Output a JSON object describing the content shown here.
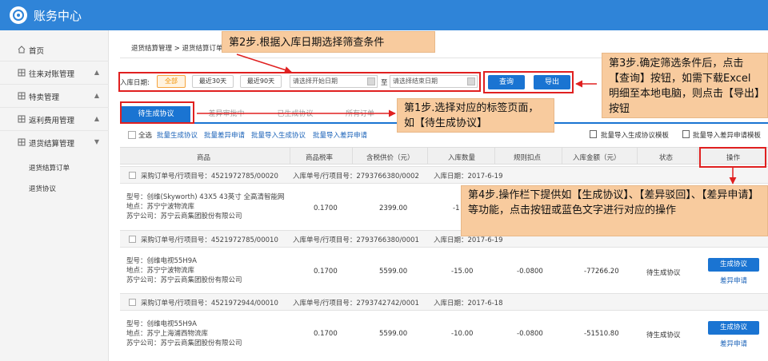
{
  "app": {
    "title": "账务中心"
  },
  "sidebar": {
    "items": [
      {
        "label": "首页"
      },
      {
        "label": "往来对账管理",
        "arrow": "▲"
      },
      {
        "label": "特卖管理",
        "arrow": "▲"
      },
      {
        "label": "返利费用管理",
        "arrow": "▲"
      },
      {
        "label": "退货结算管理",
        "arrow": "▼"
      }
    ],
    "subitems": [
      {
        "label": "退货结算订单"
      },
      {
        "label": "退货协议"
      }
    ]
  },
  "breadcrumb": "退货结算管理 > 退货结算订单",
  "filter": {
    "label": "入库日期:",
    "chips": [
      "全部",
      "最近30天",
      "最近90天"
    ],
    "start_placeholder": "请选择开始日期",
    "to": "至",
    "end_placeholder": "请选择结束日期",
    "query_label": "查询",
    "export_label": "导出"
  },
  "tabs": [
    "待生成协议",
    "差异审批中",
    "已生成协议",
    "所有订单"
  ],
  "toolbar": {
    "select_all": "全选",
    "batch_generate": "批量生成协议",
    "batch_diff_apply": "批量差异申请",
    "batch_import_generate": "批量导入生成协议",
    "batch_import_diff": "批量导入差异申请",
    "template_generate": "批量导入生成协议模板",
    "template_diff": "批量导入差异申请模板"
  },
  "table": {
    "headers": [
      "商品",
      "商品税率",
      "含税供价（元）",
      "入库数量",
      "规则扣点",
      "入库金额（元）",
      "状态",
      "操作"
    ]
  },
  "groups": [
    {
      "po": "采购订单号/行项目号：4521972785/00020",
      "receipt": "入库单号/行项目号：2793766380/0002",
      "date": "入库日期：2017-6-19",
      "model": "型号：创维(Skyworth) 43X5 43英寸 全高清智能网",
      "place": "地点：苏宁宁波物流库",
      "company": "苏宁公司：苏宁云商集团股份有限公司",
      "tax": "0.1700",
      "price": "2399.00",
      "qty": "-1",
      "point": "",
      "amount": "",
      "status": "",
      "action": "",
      "diff": ""
    },
    {
      "po": "采购订单号/行项目号：4521972785/00010",
      "receipt": "入库单号/行项目号：2793766380/0001",
      "date": "入库日期：2017-6-19",
      "model": "型号：创维电视55H9A",
      "place": "地点：苏宁宁波物流库",
      "company": "苏宁公司：苏宁云商集团股份有限公司",
      "tax": "0.1700",
      "price": "5599.00",
      "qty": "-15.00",
      "point": "-0.0800",
      "amount": "-77266.20",
      "status": "待生成协议",
      "action": "生成协议",
      "diff": "差异申请"
    },
    {
      "po": "采购订单号/行项目号：4521972944/00010",
      "receipt": "入库单号/行项目号：2793742742/0001",
      "date": "入库日期：2017-6-18",
      "model": "型号：创维电视55H9A",
      "place": "地点：苏宁上海浦西物流库",
      "company": "苏宁公司：苏宁云商集团股份有限公司",
      "tax": "0.1700",
      "price": "5599.00",
      "qty": "-10.00",
      "point": "-0.0800",
      "amount": "-51510.80",
      "status": "待生成协议",
      "action": "生成协议",
      "diff": "差异申请"
    }
  ],
  "callouts": {
    "step1": "第1步.选择对应的标签页面，如【待生成协议】",
    "step2": "第2步.根据入库日期选择筛查条件",
    "step3": "第3步.确定筛选条件后，点击【查询】按钮，如需下载Excel明细至本地电脑，则点击【导出】按钮",
    "step4": "第4步.操作栏下提供如【生成协议】、【差异驳回】、【差异申请】等功能，点击按钮或蓝色文字进行对应的操作"
  },
  "colors": {
    "brand": "#2f84d8",
    "primary_button": "#1a74d2",
    "callout": "#f8cb9e",
    "highlight": "#e02020",
    "chip_active": "#f29100"
  }
}
